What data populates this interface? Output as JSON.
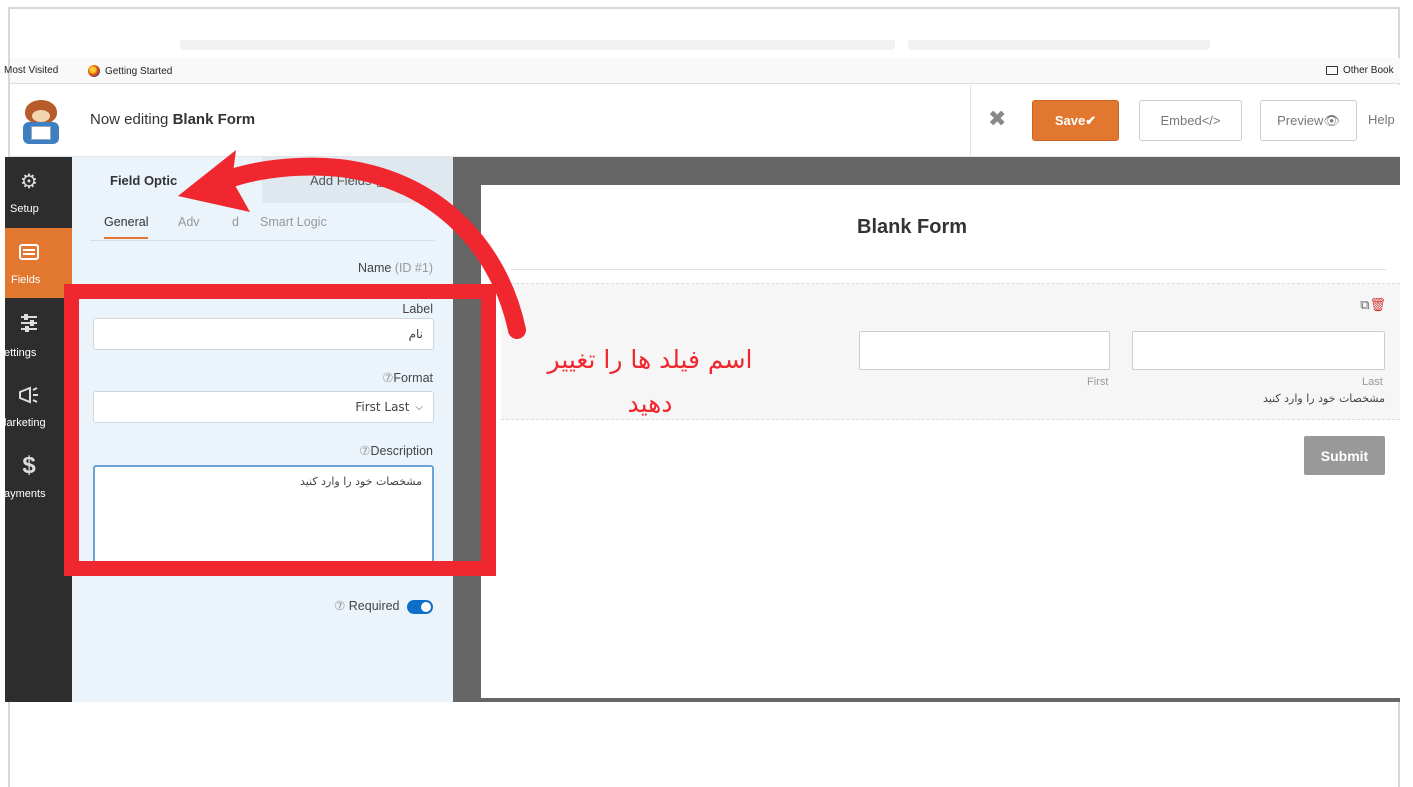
{
  "browser": {
    "bookmarks": [
      "Most Visited",
      "Getting Started"
    ],
    "other_bookmarks": "Other Book"
  },
  "header": {
    "editing_prefix": "Now editing",
    "form_name": "Blank Form",
    "close_icon": "close-x-icon",
    "save_label": "Save✔",
    "embed_label": "Embed</>",
    "preview_label": "Preview👁",
    "help_label": "Help"
  },
  "leftnav": {
    "items": [
      {
        "label": "Setup",
        "icon": "gear-icon"
      },
      {
        "label": "Fields",
        "icon": "fields-list-icon"
      },
      {
        "label": "Settings",
        "icon": "sliders-icon"
      },
      {
        "label": "Marketing",
        "icon": "megaphone-icon"
      },
      {
        "label": "Payments",
        "icon": "dollar-icon"
      }
    ],
    "labels_cropped": [
      "Setup",
      "Fields",
      "ettings",
      "larketing",
      "ayments"
    ]
  },
  "panel": {
    "tabs": [
      "Field Options",
      "Add Fields"
    ],
    "tabs_visible": [
      "Field Optic",
      "Add Fields"
    ],
    "subtabs": [
      "General",
      "Advanced",
      "Smart Logic"
    ],
    "subtabs_visible": [
      "General",
      "Adv",
      "d",
      "Smart Logic"
    ],
    "field_name": "Name",
    "field_id": "(ID #1)",
    "label_caption": "Label",
    "label_value": "نام",
    "format_caption": "Format",
    "format_value": "First Last",
    "description_caption": "Description",
    "description_value": "مشخصات خود را وارد کنید",
    "required_caption": "Required",
    "required_on": true
  },
  "preview": {
    "form_title": "Blank Form",
    "first_label": "First",
    "last_label": "Last",
    "description": "مشخصات خود را وارد کنید",
    "submit_label": "Submit"
  },
  "annotation": {
    "line1": "اسم فیلد ها را تغییر",
    "line2": "دهید",
    "color": "#f0272e"
  },
  "colors": {
    "accent": "#e27730",
    "sidebar": "#2d2d2d",
    "panel": "#ebf3fb",
    "toggle": "#0e6fc8"
  }
}
